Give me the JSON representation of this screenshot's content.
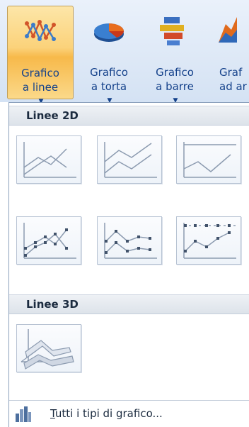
{
  "ribbon": {
    "buttons": [
      {
        "line1": "Grafico",
        "line2": "a linee",
        "icon": "line-chart-icon"
      },
      {
        "line1": "Grafico",
        "line2": "a torta",
        "icon": "pie-chart-icon"
      },
      {
        "line1": "Grafico",
        "line2": "a barre",
        "icon": "bar-chart-icon"
      },
      {
        "line1": "Graf",
        "line2": "ad ar",
        "icon": "area-chart-icon"
      }
    ]
  },
  "panel": {
    "section_2d": "Linee 2D",
    "section_3d": "Linee 3D",
    "thumbnails_2d": [
      {
        "name": "line-chart-icon"
      },
      {
        "name": "stacked-line-chart-icon"
      },
      {
        "name": "100-stacked-line-chart-icon"
      },
      {
        "name": "line-markers-chart-icon"
      },
      {
        "name": "stacked-line-markers-chart-icon"
      },
      {
        "name": "100-stacked-line-markers-chart-icon"
      }
    ],
    "thumbnails_3d": [
      {
        "name": "3d-line-chart-icon"
      }
    ],
    "footer": {
      "first_letter": "T",
      "label_rest": "utti i tipi di grafico...",
      "icon": "all-chart-types-icon"
    }
  },
  "colors": {
    "accent_blue": "#15428b",
    "active_orange": "#f7b94a",
    "line_gray": "#8c9bb0"
  }
}
